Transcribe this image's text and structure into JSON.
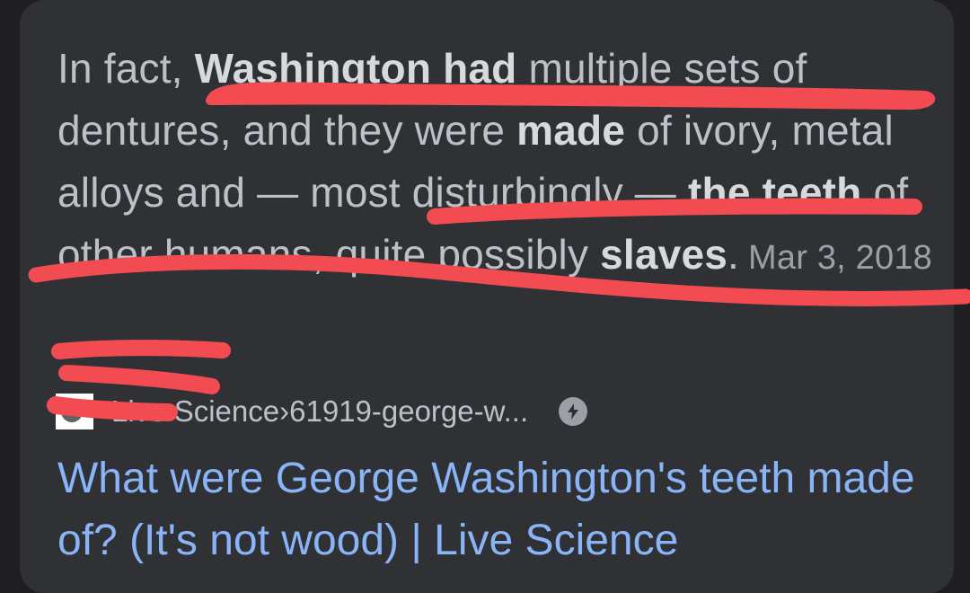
{
  "result": {
    "snippet": {
      "s1": "In fact, ",
      "b1": "Washington had",
      "s2": " multiple sets of dentures, and they were ",
      "b2": "made",
      "s3": " of ivory, metal alloys and — most disturbingly — ",
      "b3": "the teeth",
      "s4": " of other humans, quite possibly ",
      "b4": "slaves",
      "s5": "."
    },
    "date": "Mar 3, 2018",
    "source": {
      "name": "Live Science",
      "separator": " › ",
      "path": "61919-george-w..."
    },
    "title": "What were George Washington's teeth made of? (It's not wood) | Live Science"
  },
  "icons": {
    "favicon": "live-science-favicon",
    "amp": "lightning-bolt-icon"
  },
  "colors": {
    "background": "#303134",
    "snippet_text": "#bdc1c6",
    "link": "#8ab4f8",
    "annotation": "#f24c52"
  }
}
